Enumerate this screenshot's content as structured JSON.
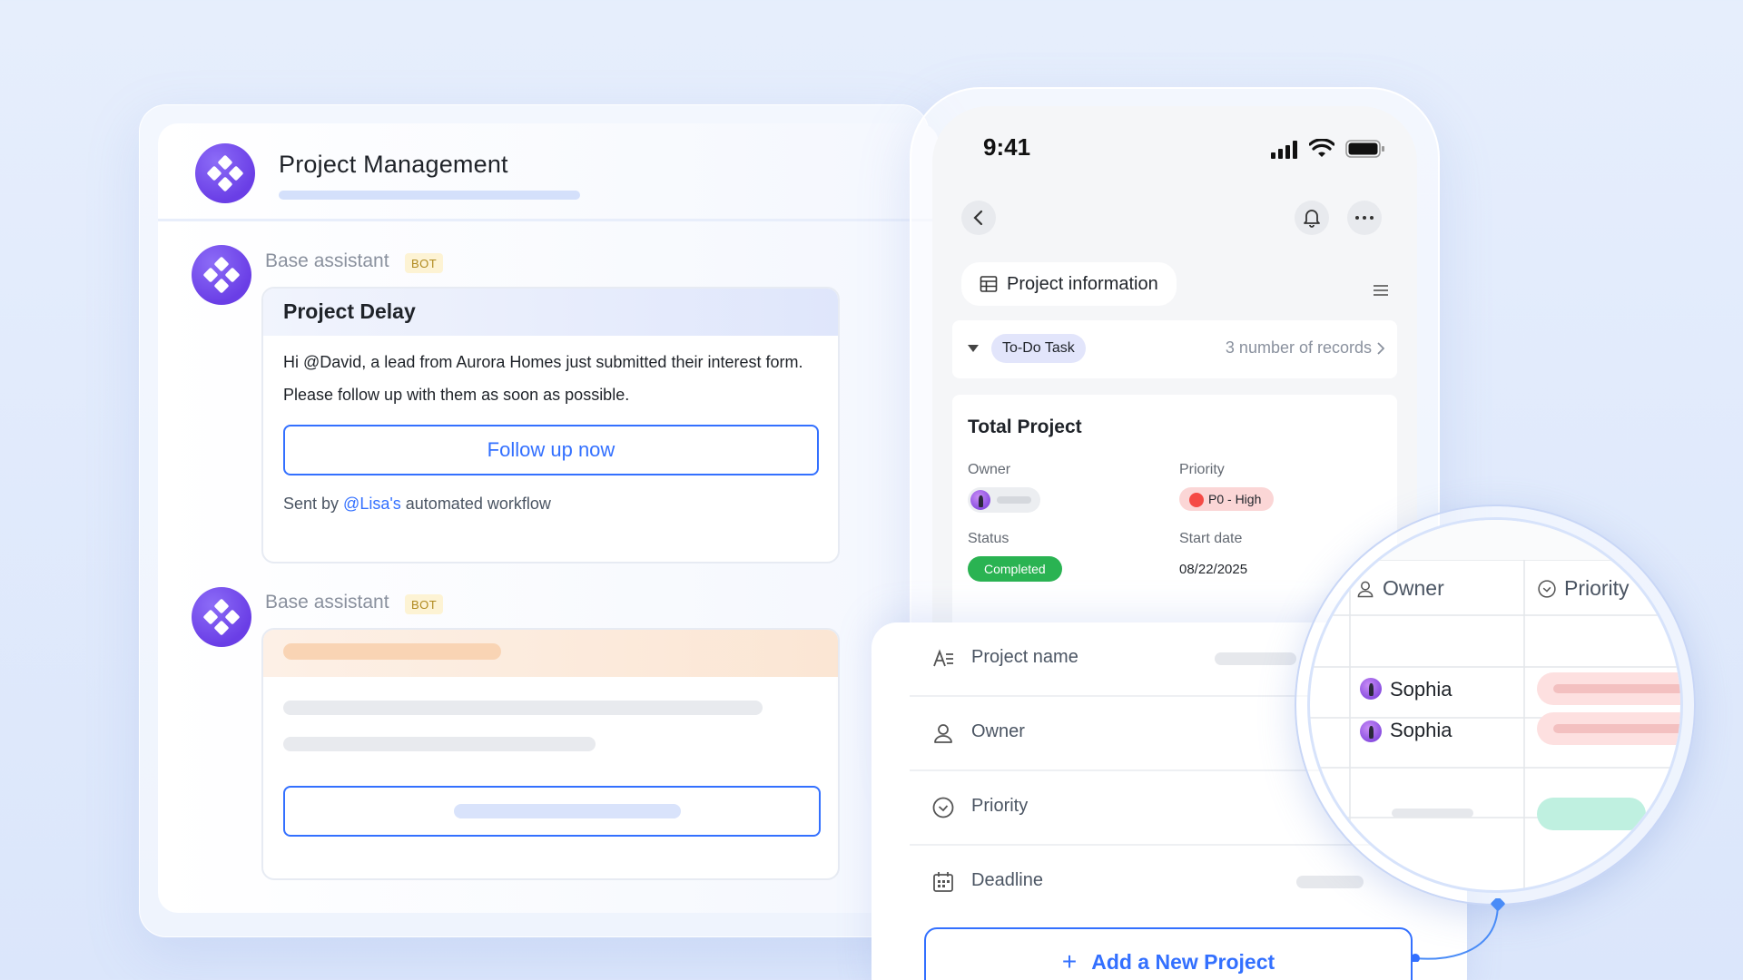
{
  "chat": {
    "title": "Project Management",
    "messages": [
      {
        "sender": "Base assistant",
        "badge": "BOT",
        "card_title": "Project Delay",
        "body_line_1": "Hi @David, a lead from Aurora Homes just submitted their interest form.",
        "body_line_2": "Please follow up with them as soon as possible.",
        "button_label": "Follow up now",
        "sent_prefix": "Sent by ",
        "sent_mention": "@Lisa's",
        "sent_suffix": " automated workflow"
      },
      {
        "sender": "Base assistant",
        "badge": "BOT"
      }
    ]
  },
  "phone": {
    "time": "9:41",
    "section_label": "Project information",
    "todo_tag": "To-Do Task",
    "records_text": "3 number of records",
    "record": {
      "title": "Total Project",
      "owner_label": "Owner",
      "priority_label": "Priority",
      "priority_value": "P0 - High",
      "status_label": "Status",
      "status_value": "Completed",
      "start_label": "Start date",
      "start_value": "08/22/2025"
    }
  },
  "form": {
    "fields": [
      {
        "label": "Project name",
        "icon": "text-field-icon"
      },
      {
        "label": "Owner",
        "icon": "person-icon"
      },
      {
        "label": "Priority",
        "icon": "check-circle-icon"
      },
      {
        "label": "Deadline",
        "icon": "calendar-icon"
      }
    ],
    "add_button": "Add a New Project",
    "add_button_icon": "+"
  },
  "magnifier": {
    "headers": [
      "Owner",
      "Priority"
    ],
    "rows": [
      {
        "owner": "Sophia"
      },
      {
        "owner": "Sophia"
      }
    ]
  },
  "colors": {
    "accent": "#3370ff",
    "brand_purple": "#6a3ee6",
    "status_green": "#2ab352",
    "priority_red": "#f54a45"
  }
}
